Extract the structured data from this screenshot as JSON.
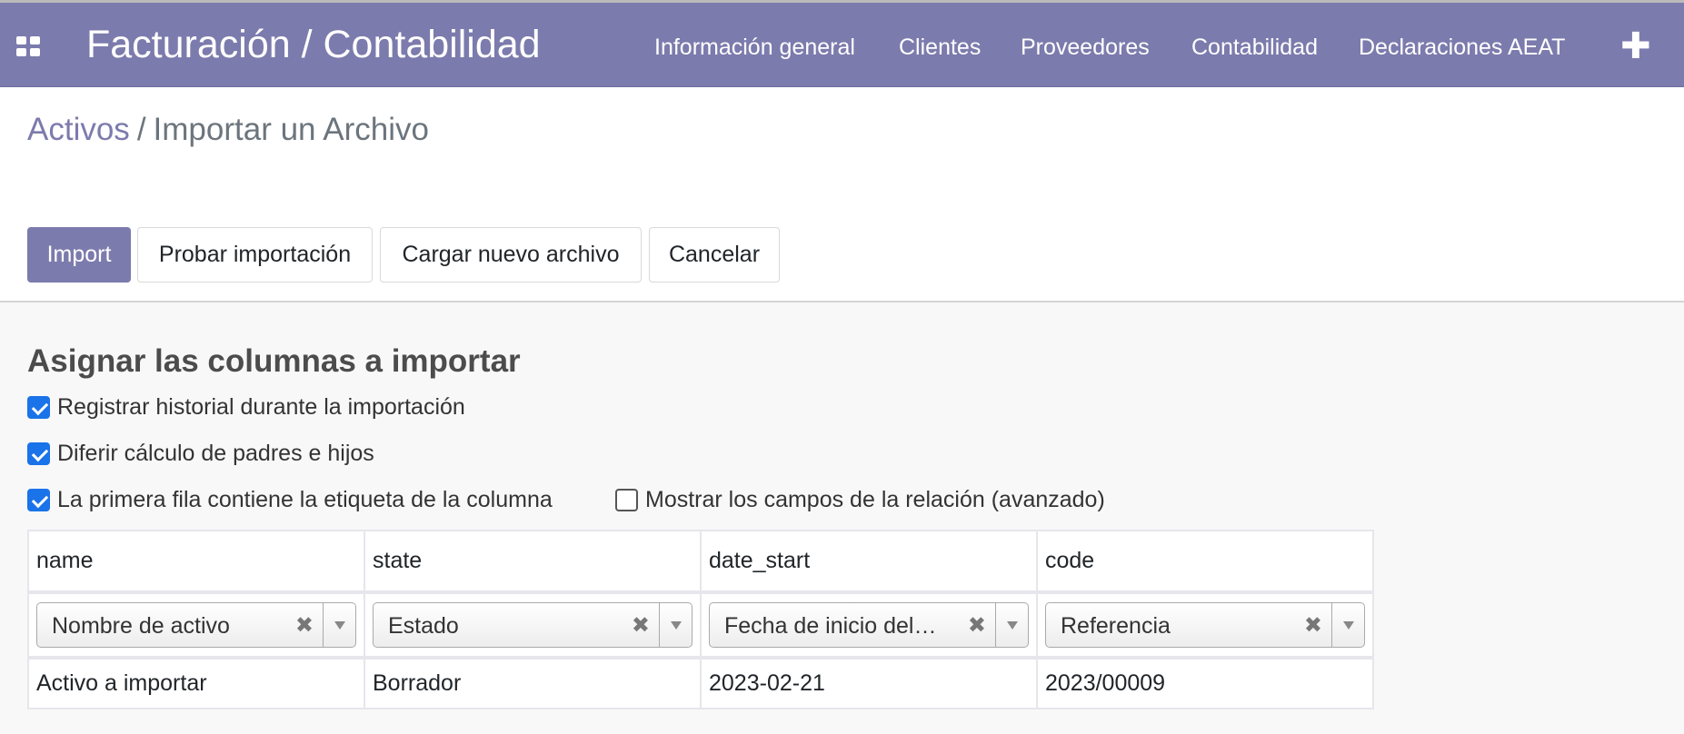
{
  "navbar": {
    "brand": "Facturación / Contabilidad",
    "menu": [
      "Información general",
      "Clientes",
      "Proveedores",
      "Contabilidad",
      "Declaraciones AEAT"
    ],
    "add_label": "✚"
  },
  "breadcrumb": {
    "parent": "Activos",
    "separator": "/",
    "current": "Importar un Archivo"
  },
  "buttons": {
    "import": "Import",
    "test_import": "Probar importación",
    "load_new": "Cargar nuevo archivo",
    "cancel": "Cancelar"
  },
  "section": {
    "title": "Asignar las columnas a importar"
  },
  "options": {
    "track_history": {
      "label": "Registrar historial durante la importación",
      "checked": true
    },
    "defer_parent": {
      "label": "Diferir cálculo de padres e hijos",
      "checked": true
    },
    "header_row": {
      "label": "La primera fila contiene la etiqueta de la columna",
      "checked": true
    },
    "show_relations": {
      "label": "Mostrar los campos de la relación (avanzado)",
      "checked": false
    }
  },
  "table": {
    "columns": [
      "name",
      "state",
      "date_start",
      "code"
    ],
    "fields": [
      "Nombre de activo",
      "Estado",
      "Fecha de inicio del…",
      "Referencia"
    ],
    "row": [
      "Activo a importar",
      "Borrador",
      "2023-02-21",
      "2023/00009"
    ],
    "clear_symbol": "✖"
  },
  "colors": {
    "brand": "#7c7bad",
    "checkbox": "#1a73e8"
  }
}
